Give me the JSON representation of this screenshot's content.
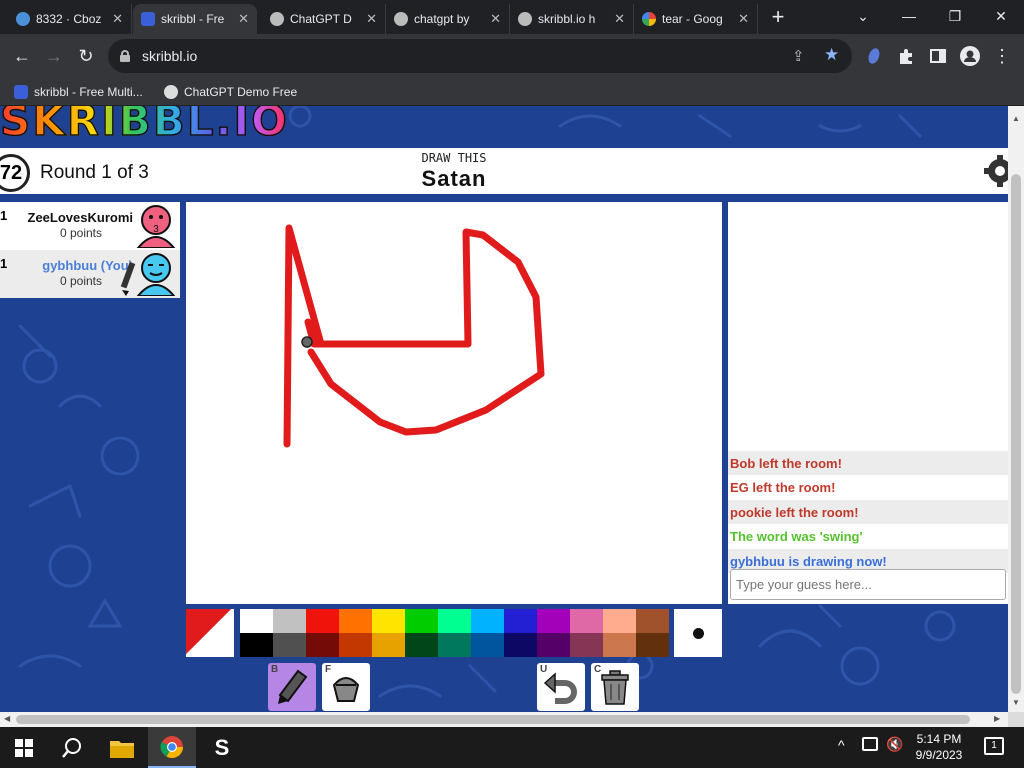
{
  "browser": {
    "tabs": [
      {
        "title": "8332 · Cboz",
        "favicon_color": "#4a90d9"
      },
      {
        "title": "skribbl - Fre",
        "favicon_color": "#3b5fd9",
        "active": true
      },
      {
        "title": "ChatGPT D",
        "favicon_color": "#bbbbbb"
      },
      {
        "title": "chatgpt by",
        "favicon_color": "#bbbbbb"
      },
      {
        "title": "skribbl.io h",
        "favicon_color": "#bbbbbb"
      },
      {
        "title": "tear - Goog",
        "favicon_color": "#ffffff"
      }
    ],
    "new_tab": "+",
    "window_controls": {
      "chevron": "⌄",
      "minimize": "—",
      "restore": "❐",
      "close": "✕"
    },
    "url": "skribbl.io",
    "bookmarks": [
      {
        "label": "skribbl - Free Multi...",
        "icon": "skribbl-pencil-icon"
      },
      {
        "label": "ChatGPT Demo Free",
        "icon": "globe-icon"
      }
    ]
  },
  "game": {
    "logo_text": "SKRIBBL.IO",
    "timer": "72",
    "round_label": "Round 1 of 3",
    "draw_this_label": "DRAW THIS",
    "word": "Satan",
    "players": [
      {
        "rank": "1",
        "name": "ZeeLovesKuromi",
        "points": "0 points",
        "color": "#111111",
        "avatar_color": "#f06080"
      },
      {
        "rank": "1",
        "name": "gybhbuu (You)",
        "points": "0 points",
        "color": "#4a7fd8",
        "avatar_color": "#46c8f0"
      }
    ],
    "chat": [
      {
        "text": "Bob left the room!",
        "color": "#c0392b"
      },
      {
        "text": "EG left the room!",
        "color": "#c0392b"
      },
      {
        "text": "pookie left the room!",
        "color": "#c0392b"
      },
      {
        "text": "The word was 'swing'",
        "color": "#56c22e"
      },
      {
        "text": "gybhbuu is drawing now!",
        "color": "#3a6fd8"
      }
    ],
    "guess_placeholder": "Type your guess here...",
    "palette": {
      "top": [
        "#ffffff",
        "#c1c1c1",
        "#ef130b",
        "#ff7100",
        "#ffe400",
        "#00cc00",
        "#00ff91",
        "#00b2ff",
        "#231fd3",
        "#a300ba",
        "#df69a7",
        "#ffac8e",
        "#a0522d"
      ],
      "bottom": [
        "#000000",
        "#505050",
        "#740b07",
        "#c23800",
        "#e8a200",
        "#004619",
        "#00785d",
        "#00569e",
        "#0e0865",
        "#550069",
        "#873554",
        "#cc774d",
        "#63300d"
      ]
    },
    "tools": [
      {
        "key": "B",
        "name": "pencil"
      },
      {
        "key": "F",
        "name": "fill"
      },
      {
        "key": "U",
        "name": "undo"
      },
      {
        "key": "C",
        "name": "clear"
      }
    ],
    "stroke_color": "#e11b1b"
  },
  "taskbar": {
    "time": "5:14 PM",
    "date": "9/9/2023",
    "notification_count": "1"
  }
}
